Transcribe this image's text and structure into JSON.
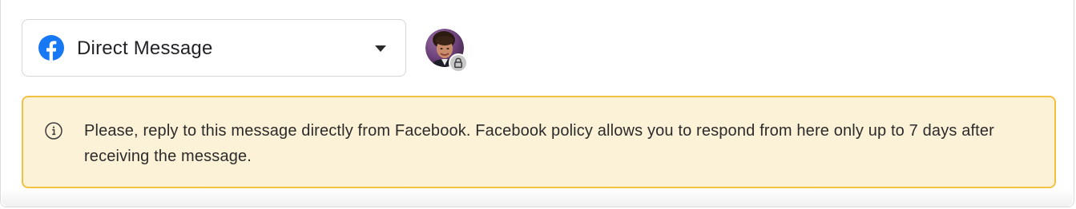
{
  "channel_selector": {
    "label": "Direct Message",
    "icon": "facebook-icon",
    "brand_color": "#1877f2",
    "dropdown_icon": "caret-down-icon"
  },
  "account": {
    "avatar_icon": "avatar",
    "badge_icon": "lock-icon"
  },
  "notice": {
    "icon": "info-icon",
    "text": "Please, reply to this message directly from Facebook. Facebook policy allows you to respond from here only up to 7 days after receiving the message.",
    "background_color": "#fcf2d7",
    "border_color": "#f3c142"
  }
}
